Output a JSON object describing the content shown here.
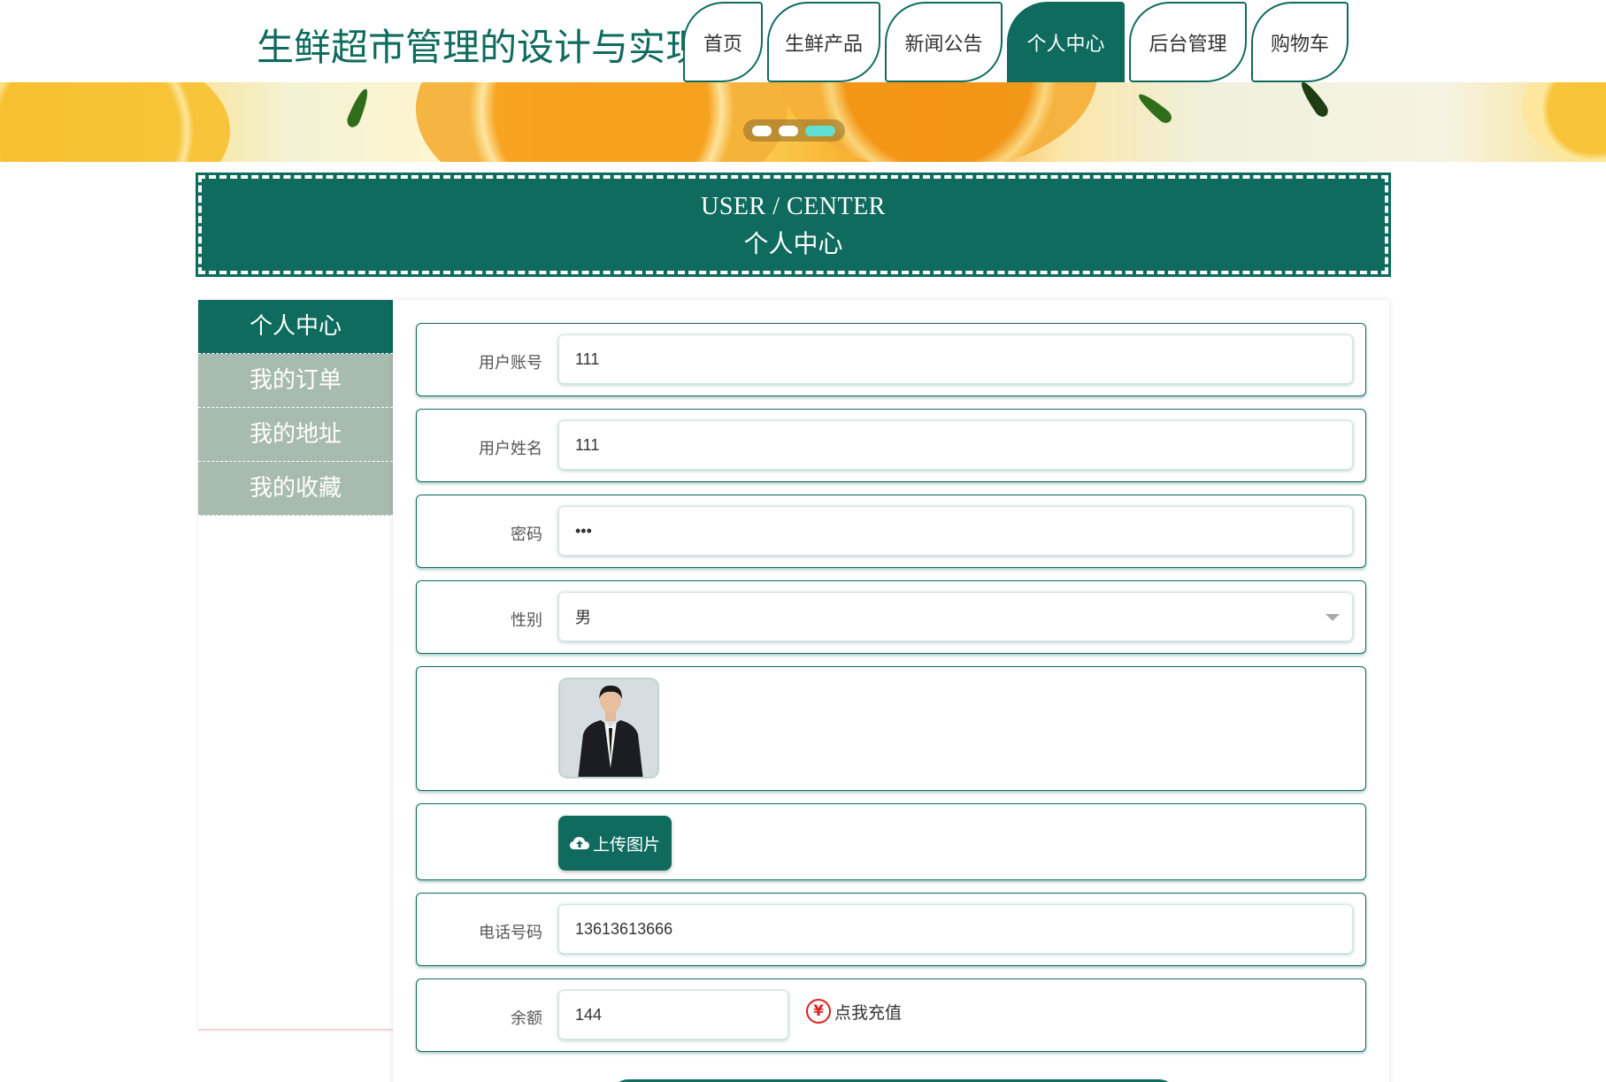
{
  "header": {
    "site_title": "生鲜超市管理的设计与实现",
    "nav": [
      {
        "label": "首页",
        "active": false
      },
      {
        "label": "生鲜产品",
        "active": false
      },
      {
        "label": "新闻公告",
        "active": false
      },
      {
        "label": "个人中心",
        "active": true
      },
      {
        "label": "后台管理",
        "active": false
      },
      {
        "label": "购物车",
        "active": false
      }
    ]
  },
  "banner": {
    "slide_count": 3,
    "active_slide": 3
  },
  "section": {
    "title_en": "USER / CENTER",
    "title_cn": "个人中心"
  },
  "sidebar": {
    "items": [
      {
        "label": "个人中心",
        "active": true
      },
      {
        "label": "我的订单",
        "active": false
      },
      {
        "label": "我的地址",
        "active": false
      },
      {
        "label": "我的收藏",
        "active": false
      }
    ]
  },
  "form": {
    "username": {
      "label": "用户账号",
      "value": "111"
    },
    "name": {
      "label": "用户姓名",
      "value": "111"
    },
    "password": {
      "label": "密码",
      "value": "•••"
    },
    "gender": {
      "label": "性别",
      "value": "男"
    },
    "upload": {
      "label": "上传图片",
      "icon": "cloud-upload-icon"
    },
    "phone": {
      "label": "电话号码",
      "value": "13613613666"
    },
    "balance": {
      "label": "余额",
      "value": "144",
      "recharge_label": "点我充值",
      "recharge_icon": "¥"
    }
  },
  "colors": {
    "primary": "#0e6b5e",
    "sidebar_inactive": "#a8bbaf",
    "recharge_icon": "#e0201a",
    "slider_active_dot": "#5fe0d2"
  }
}
